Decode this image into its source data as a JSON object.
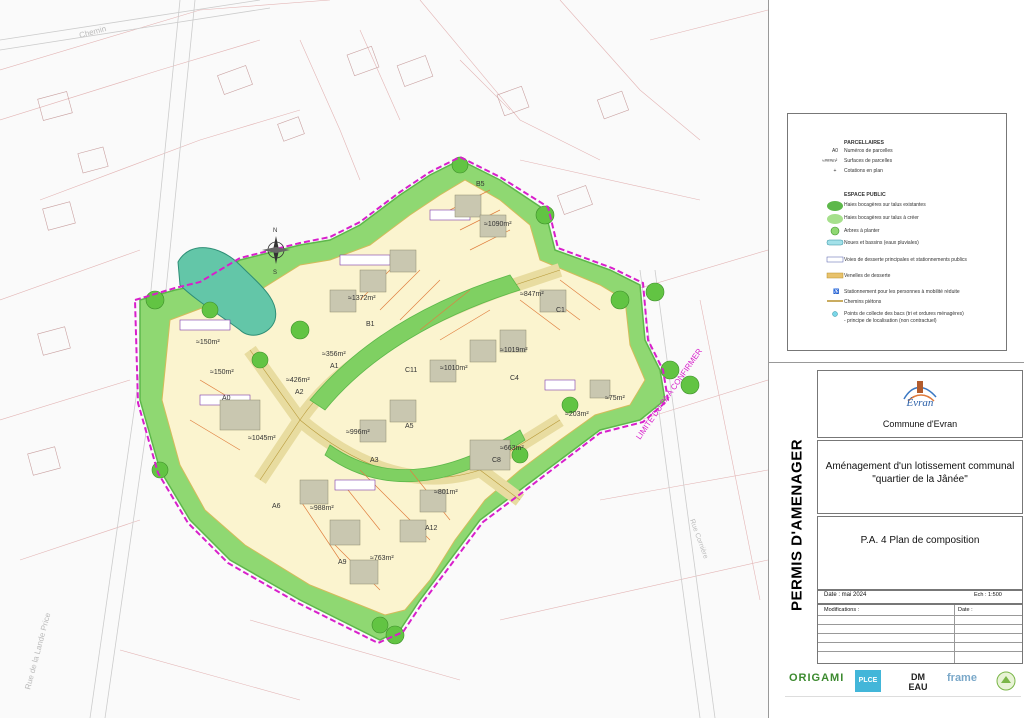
{
  "map": {
    "limit_label": "LIMITE DU PA\nA CONFIRMER",
    "north": {
      "n": "N",
      "s": "S",
      "e": "E",
      "w": "W"
    },
    "streets": [
      "Chemin",
      "Rue de la Lande Price",
      "Rue Cornière"
    ],
    "lots": [
      {
        "id": "A0",
        "area": "≈1045m²"
      },
      {
        "id": "A1",
        "area": "≈356m²"
      },
      {
        "id": "A2",
        "area": "≈426m²"
      },
      {
        "id": "A3",
        "area": "≈996m²"
      },
      {
        "id": "A5",
        "area": ""
      },
      {
        "id": "A6",
        "area": "≈988m²"
      },
      {
        "id": "A9",
        "area": "≈763m²"
      },
      {
        "id": "A12",
        "area": "≈801m²"
      },
      {
        "id": "B1",
        "area": "≈1372m²"
      },
      {
        "id": "B5",
        "area": "≈1090m²"
      },
      {
        "id": "C1",
        "area": "≈847m²"
      },
      {
        "id": "C4",
        "area": "≈1019m²"
      },
      {
        "id": "C11",
        "area": "≈1010m²"
      },
      {
        "id": "C8",
        "area": "≈663m²"
      },
      {
        "id": "C10",
        "area": "≈203m²"
      },
      {
        "id": "C7",
        "area": "≈75m²"
      },
      {
        "id": "A4",
        "area": "≈150m²"
      },
      {
        "id": "A7",
        "area": "≈150m²"
      }
    ]
  },
  "legend": {
    "parcellaires": "PARCELLAIRES",
    "num_symbol": "A0",
    "num_label": "Numéros de parcelles",
    "surf_symbol": "≈###m²",
    "surf_label": "Surfaces de parcelles",
    "cot_label": "Cotations en plan",
    "espace_public": "ESPACE PUBLIC",
    "items": [
      "Haies bocagères sur talus existantes",
      "Haies bocagères sur talus à créer",
      "Arbres à planter",
      "Noues et bassins (eaux pluviales)",
      "Voies de desserte principales et stationnements publics",
      "Venelles de desserte",
      "Stationnement pour les personnes à mobilité réduite",
      "Chemins piétons",
      "Points de collecte des bacs (tri et ordures ménagères)",
      "- principe de localisation (non contractuel)"
    ]
  },
  "cartouche": {
    "vertical_title": "PERMIS D'AMENAGER",
    "commune_logo": "Évran",
    "commune": "Commune d'Evran",
    "project_line1": "Aménagement d'un lotissement communal",
    "project_line2": "\"quartier de la Jânée\"",
    "plan": "P.A. 4 Plan de composition",
    "date": "Date : mai 2024",
    "scale": "Ech : 1:500",
    "modifications": "Modifications :",
    "date2": "Date :",
    "logos": [
      "ORIGAMI",
      "PLCE",
      "DM EAU",
      "frame"
    ]
  }
}
